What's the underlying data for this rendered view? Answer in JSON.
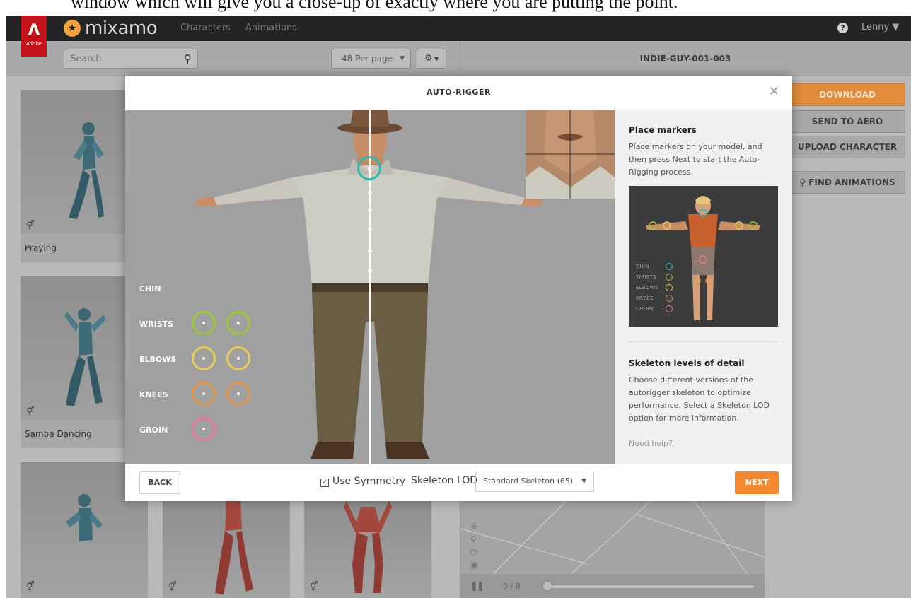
{
  "caption": "window which will give you a close-up of exactly where you are putting the point.",
  "header": {
    "adobe_badge": "Adobe",
    "brand": "mixamo",
    "nav": [
      "Characters",
      "Animations"
    ],
    "user": "Lenny",
    "help_symbol": "?"
  },
  "toolbar": {
    "search_placeholder": "Search",
    "per_page": "48 Per page",
    "character_name": "INDIE-GUY-001-003"
  },
  "grid": {
    "items": [
      {
        "label": "Praying"
      },
      {
        "label": "Samba Dancing"
      },
      {
        "label": ""
      }
    ]
  },
  "side_buttons": {
    "download": "DOWNLOAD",
    "send_to_aero": "SEND TO AERO",
    "upload_character": "UPLOAD CHARACTER",
    "find_animations": "FIND ANIMATIONS"
  },
  "viewer": {
    "frame_count": "0 / 0"
  },
  "modal": {
    "title": "AUTO-RIGGER",
    "markers": {
      "chin": "CHIN",
      "wrists": "WRISTS",
      "elbows": "ELBOWS",
      "knees": "KNEES",
      "groin": "GROIN"
    },
    "marker_colors": {
      "chin": "#2ab9b5",
      "wrists": "#9ec63b",
      "elbows": "#e8cd5a",
      "knees": "#e1954a",
      "groin": "#e07b95"
    },
    "panel": {
      "place_markers_title": "Place markers",
      "place_markers_text": "Place markers on your model, and then press Next to start the Auto-Rigging process.",
      "ref_legend": [
        "CHIN",
        "WRISTS",
        "ELBOWS",
        "KNEES",
        "GROIN"
      ],
      "skeleton_title": "Skeleton levels of detail",
      "skeleton_text": "Choose different versions of the autorigger skeleton to optimize performance. Select a Skeleton LOD option for more information.",
      "need_help": "Need help?"
    },
    "footer": {
      "back": "BACK",
      "use_symmetry": "Use Symmetry",
      "use_symmetry_checked": true,
      "skeleton_lod_label": "Skeleton LOD",
      "skeleton_lod_value": "Standard Skeleton (65)",
      "next": "NEXT"
    }
  }
}
